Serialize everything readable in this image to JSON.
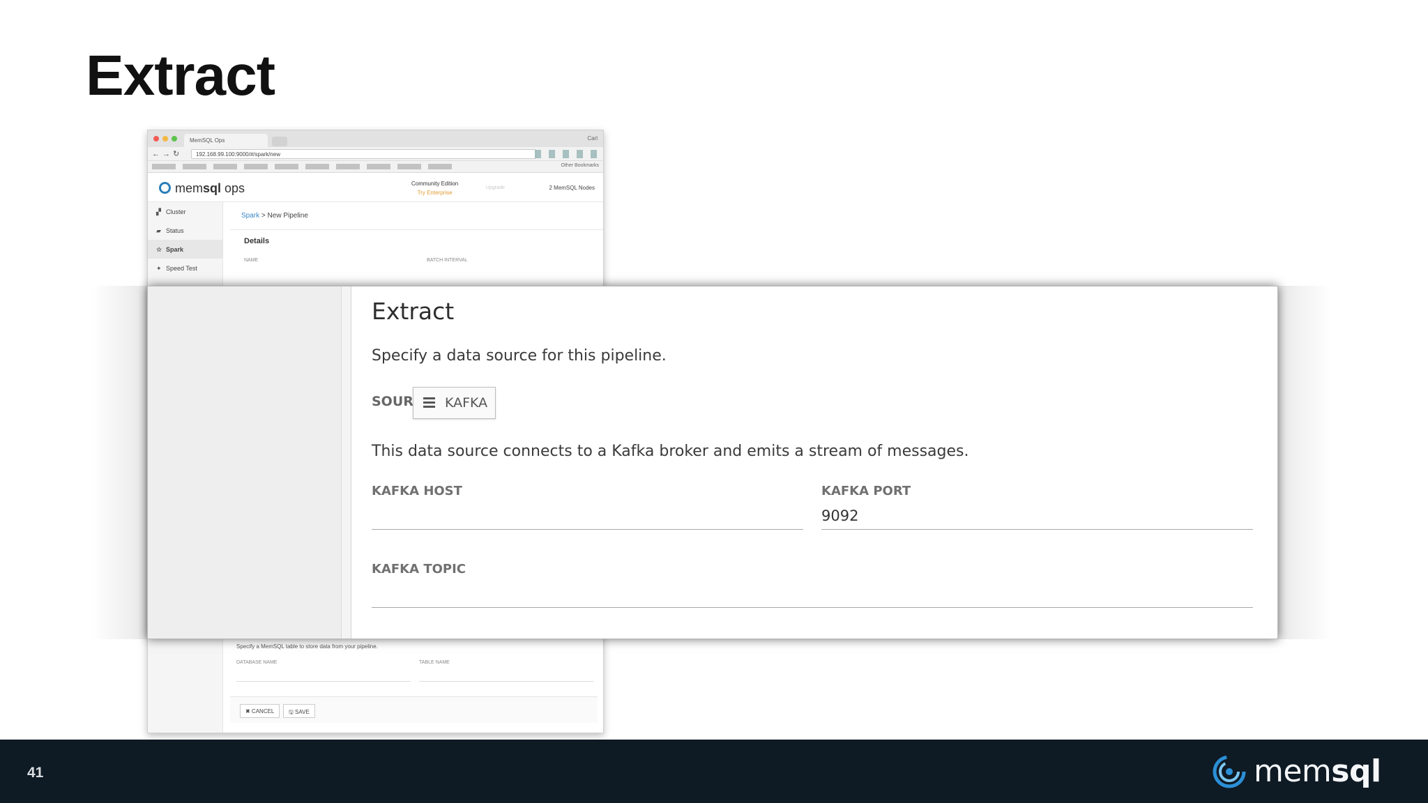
{
  "slide": {
    "title": "Extract",
    "page_number": "41",
    "brand": {
      "regular": "mem",
      "bold": "sql"
    }
  },
  "mini_browser": {
    "tab_title": "MemSQL Ops",
    "user": "Carl",
    "url": "192.168.99.100:9000/#/spark/new",
    "other_bookmarks": "Other Bookmarks",
    "app": {
      "logo_regular": "mem",
      "logo_bold": "sql",
      "logo_suffix": " ops",
      "edition": "Community Edition",
      "upgrade": "Try Enterprise",
      "faded_link": "Upgrade",
      "nodes": "2 MemSQL Nodes"
    },
    "sidebar": [
      {
        "icon": "cluster-icon",
        "glyph": "▞",
        "label": "Cluster"
      },
      {
        "icon": "status-icon",
        "glyph": "▰",
        "label": "Status"
      },
      {
        "icon": "spark-icon",
        "glyph": "☆",
        "label": "Spark"
      },
      {
        "icon": "speed-test-icon",
        "glyph": "✦",
        "label": "Speed Test"
      }
    ],
    "breadcrumb": {
      "parent": "Spark",
      "separator": " > ",
      "current": "New Pipeline"
    },
    "details_heading": "Details",
    "details_labels": {
      "name": "NAME",
      "batch_interval": "BATCH INTERVAL"
    },
    "load_text": "Specify a MemSQL table to store data from your pipeline.",
    "load_labels": {
      "database": "DATABASE NAME",
      "table": "TABLE NAME"
    },
    "buttons": {
      "cancel": "✖ CANCEL",
      "save": "🖫 SAVE"
    }
  },
  "extract_panel": {
    "title": "Extract",
    "description": "Specify a data source for this pipeline.",
    "source_label": "SOURCE",
    "source_value": "KAFKA",
    "source_description": "This data source connects to a Kafka broker and emits a stream of messages.",
    "fields": {
      "host": {
        "label": "KAFKA HOST",
        "value": ""
      },
      "port": {
        "label": "KAFKA PORT",
        "value": "9092"
      },
      "topic": {
        "label": "KAFKA TOPIC",
        "value": ""
      }
    }
  },
  "colors": {
    "footer_bg": "#0e1a24",
    "link": "#3b87c8",
    "brand_blue": "#2b7fb8",
    "upgrade_orange": "#e29a2f"
  }
}
